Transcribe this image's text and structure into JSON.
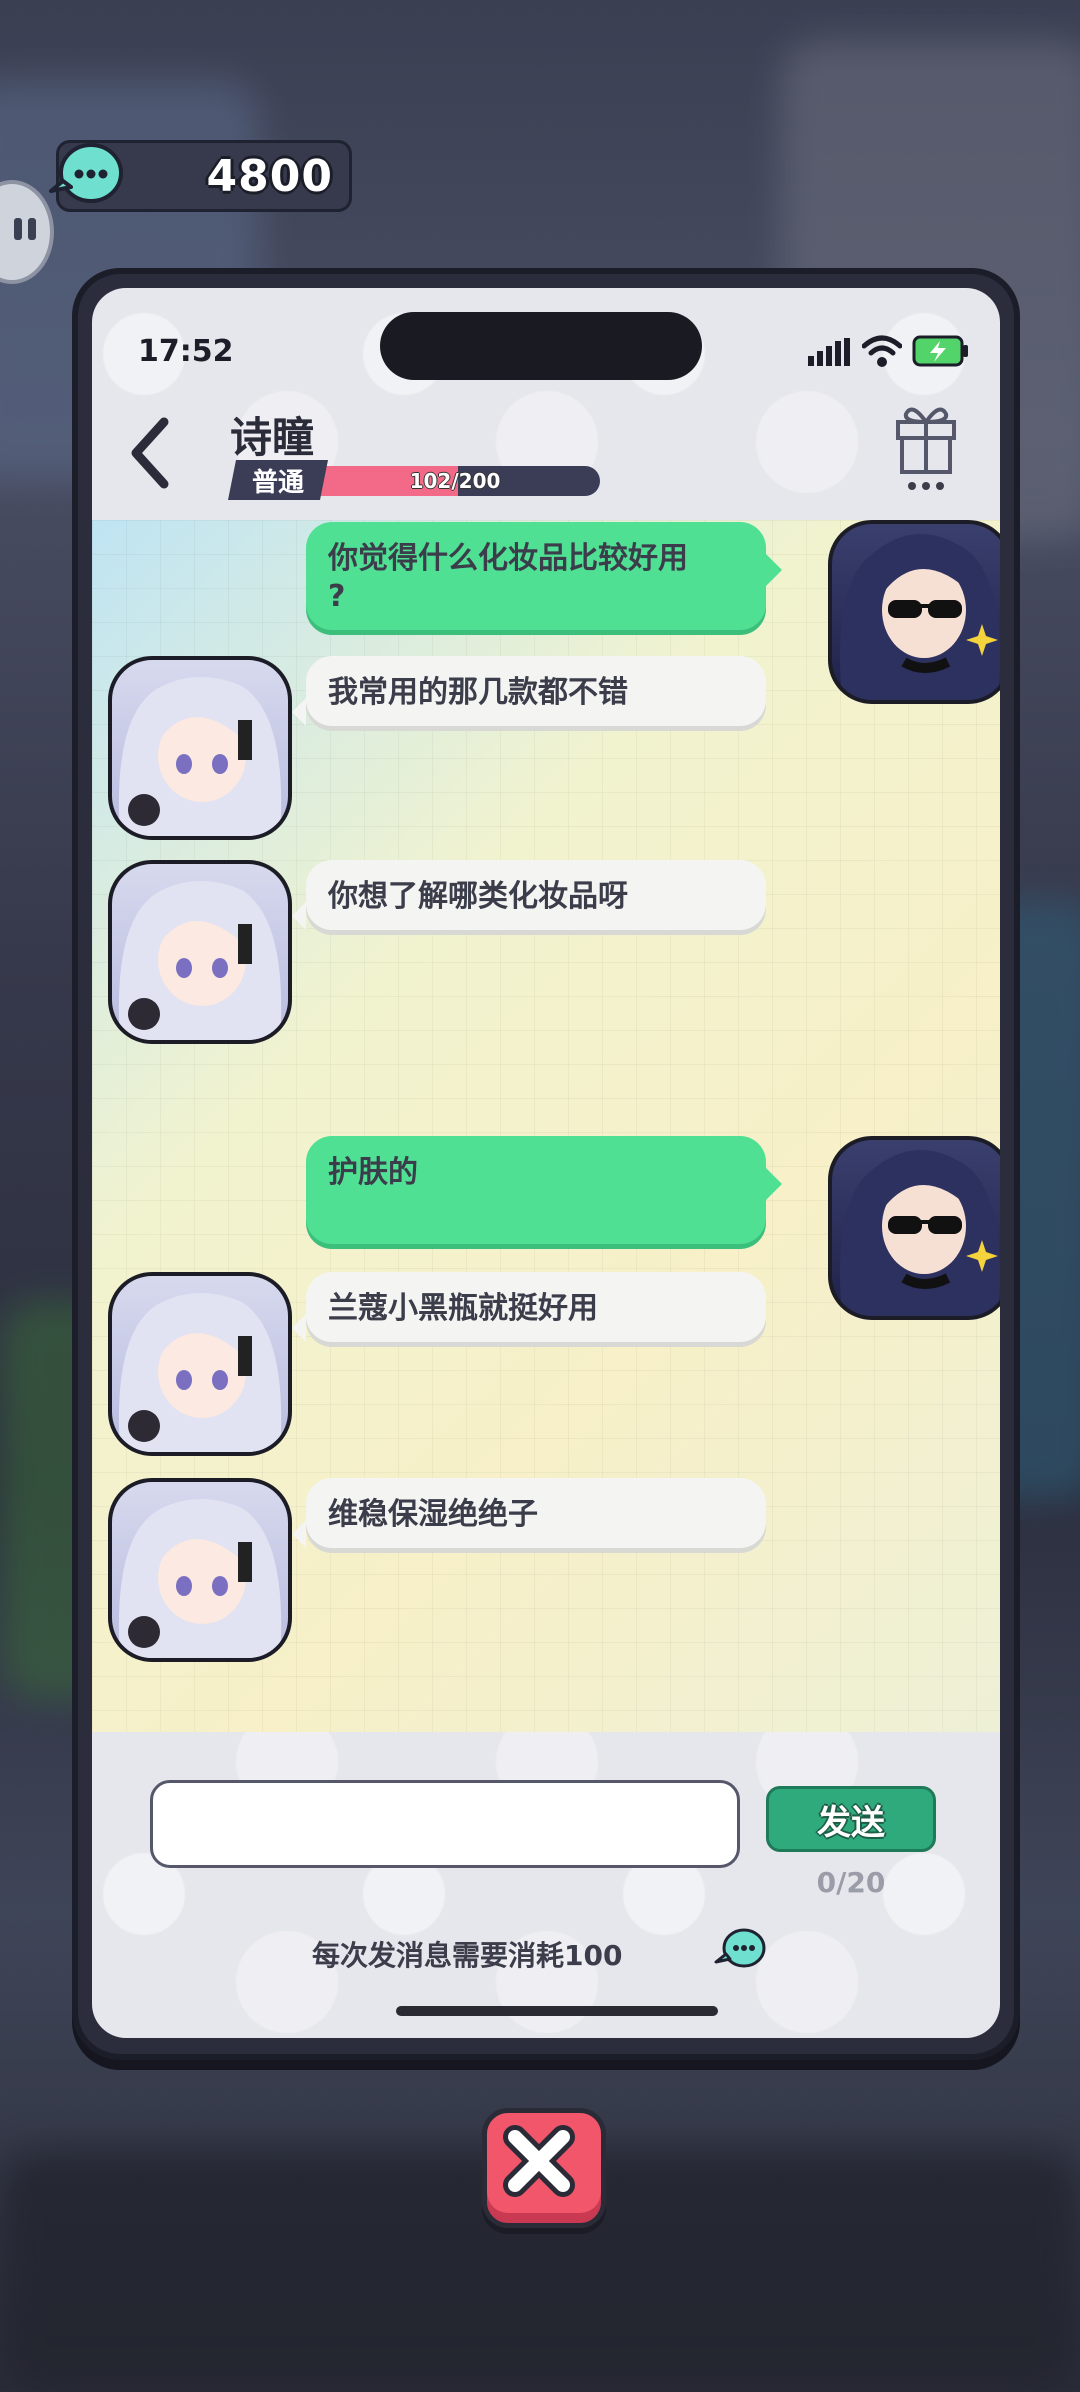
{
  "currency": {
    "value": "4800",
    "icon": "chat-bubble-coin-icon"
  },
  "status_bar": {
    "time": "17:52"
  },
  "header": {
    "contact_name": "诗瞳",
    "level_label": "普通",
    "affection_text": "102/200",
    "affection_fraction": 0.51
  },
  "messages": [
    {
      "sender": "me",
      "text": "你觉得什么化妆品比较好用\n?"
    },
    {
      "sender": "npc",
      "text": "我常用的那几款都不错"
    },
    {
      "sender": "npc",
      "text": "你想了解哪类化妆品呀"
    },
    {
      "sender": "me",
      "text": "护肤的"
    },
    {
      "sender": "npc",
      "text": "兰蔻小黑瓶就挺好用"
    },
    {
      "sender": "npc",
      "text": "维稳保湿绝绝子"
    }
  ],
  "composer": {
    "input_value": "",
    "send_label": "发送",
    "char_count": "0/20",
    "cost_note": "每次发消息需要消耗100"
  },
  "colors": {
    "my_bubble": "#4fe094",
    "npc_bubble": "#f4f4f2",
    "send_button": "#2faa7d",
    "close_button": "#f2566b",
    "affection_fill": "#f26a88"
  }
}
